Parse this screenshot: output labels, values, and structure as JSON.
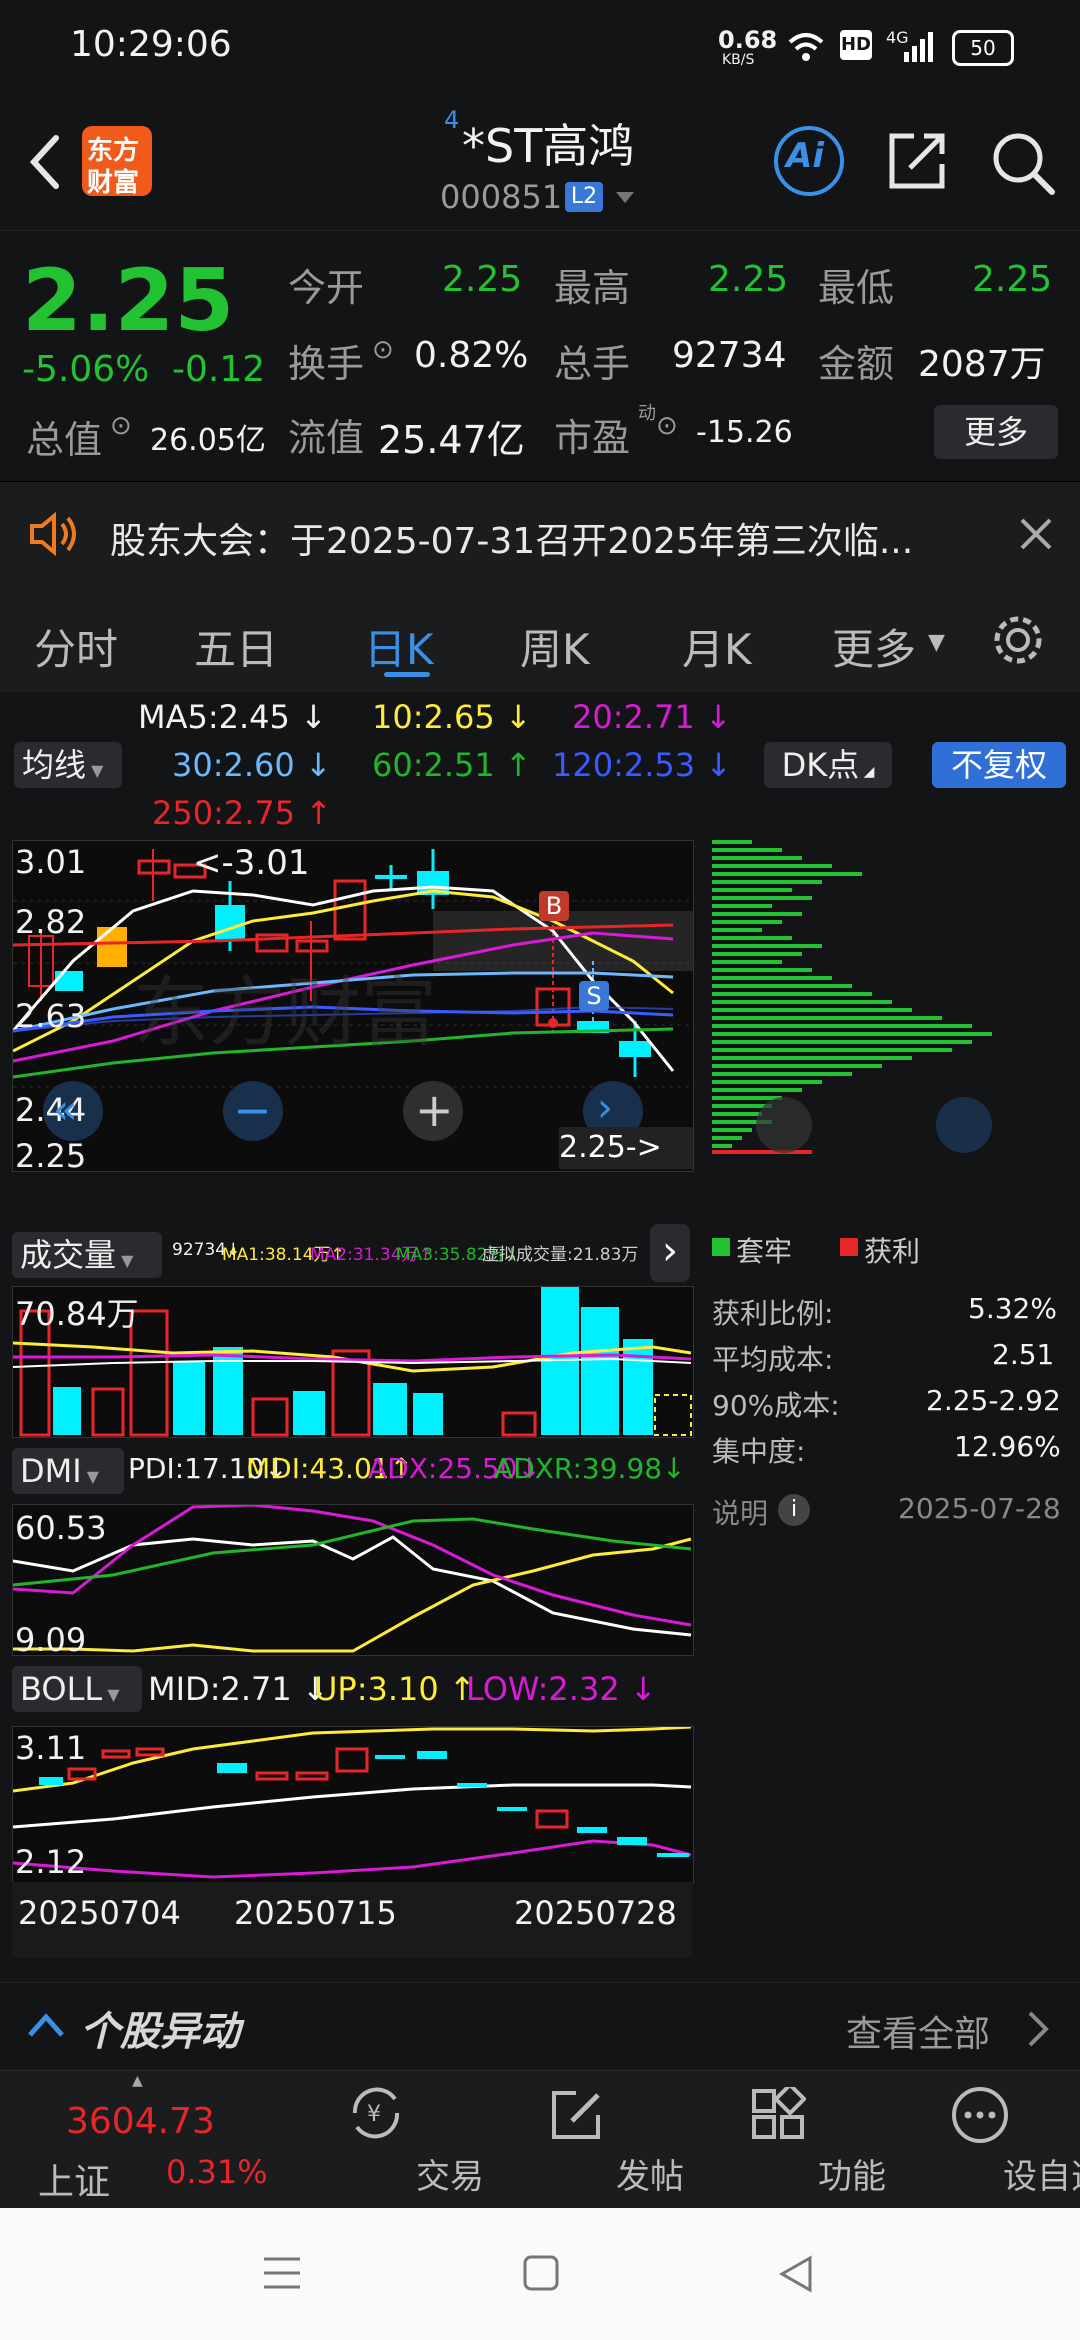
{
  "status": {
    "time": "10:29:06",
    "net_speed": "0.68",
    "net_unit": "KB/S",
    "hd": "HD",
    "signal": "4G",
    "battery": "50"
  },
  "header": {
    "logo_line1": "东方",
    "logo_line2": "财富",
    "sup": "4",
    "name": "*ST高鸿",
    "code": "000851",
    "level": "L2",
    "ai": "Ai"
  },
  "quote": {
    "price": "2.25",
    "pct": "-5.06%",
    "chg": "-0.12",
    "open_label": "今开",
    "open": "2.25",
    "high_label": "最高",
    "high": "2.25",
    "low_label": "最低",
    "low": "2.25",
    "turnover_label": "换手",
    "turnover": "0.82%",
    "volume_label": "总手",
    "volume": "92734",
    "amount_label": "金额",
    "amount": "2087万",
    "mcap_label": "总值",
    "mcap": "26.05亿",
    "float_label": "流值",
    "float": "25.47亿",
    "pe_label": "市盈",
    "pe_sup": "动",
    "pe": "-15.26",
    "more": "更多"
  },
  "notice": {
    "text": "股东大会：于2025-07-31召开2025年第三次临..."
  },
  "tabs": [
    "分时",
    "五日",
    "日K",
    "周K",
    "月K",
    "更多"
  ],
  "active_tab": "日K",
  "ma": {
    "button": "均线",
    "ma5": "MA5:2.45 ↓",
    "ma10": "10:2.65 ↓",
    "ma20": "20:2.71 ↓",
    "ma30": "30:2.60 ↓",
    "ma60": "60:2.51 ↑",
    "ma120": "120:2.53 ↓",
    "ma250": "250:2.75 ↑",
    "dk": "DK点",
    "fq": "不复权"
  },
  "kline": {
    "y_labels": [
      "3.01",
      "2.82",
      "2.63",
      "2.44",
      "2.25"
    ],
    "max_note": "<-3.01",
    "last_note": "2.25->",
    "b": "B",
    "s": "S",
    "watermark": "东方财富"
  },
  "volume": {
    "button": "成交量",
    "vol": "92734↓",
    "ma1": "MA1:38.14万↑",
    "ma2": "MA2:31.34万↑",
    "ma3": "MA3:35.82万↓",
    "virtual": "虚拟成交量:21.83万",
    "axis_top": "70.84万"
  },
  "dmi": {
    "button": "DMI",
    "pdi": "PDI:17.10↓",
    "mdi": "MDI:43.01↑",
    "adx": "ADX:25.50↓",
    "adxr": "ADXR:39.98↓",
    "y_top": "60.53",
    "y_bot": "9.09"
  },
  "boll": {
    "button": "BOLL",
    "mid": "MID:2.71 ↓",
    "up": "UP:3.10 ↑",
    "low": "LOW:2.32 ↓",
    "y_top": "3.11",
    "y_bot": "2.12"
  },
  "dates": [
    "20250704",
    "20250715",
    "20250728"
  ],
  "chip": {
    "legend_trapped": "套牢",
    "legend_profit": "获利",
    "rows": [
      {
        "k": "获利比例:",
        "v": "5.32%"
      },
      {
        "k": "平均成本:",
        "v": "2.51"
      },
      {
        "k": "90%成本:",
        "v": "2.25-2.92"
      },
      {
        "k": "集中度:",
        "v": "12.96%"
      }
    ],
    "note": "说明",
    "date": "2025-07-28"
  },
  "abnormal": {
    "title": "个股异动",
    "view_all": "查看全部"
  },
  "bottom": {
    "index_value": "3604.73",
    "index_name": "上证",
    "index_pct": "0.31%",
    "items": [
      "交易",
      "发帖",
      "功能",
      "设自选"
    ]
  },
  "colors": {
    "up": "#e8262a",
    "down": "#22c232",
    "accent": "#3a8fe6",
    "ma5": "#ffffff",
    "ma10": "#ffeb3b",
    "ma20": "#d81bd6",
    "ma30": "#6cb8ff",
    "ma60": "#22b52a",
    "ma120": "#3a5bff",
    "ma250": "#e8262a",
    "candle_down": "#00f0ff"
  }
}
